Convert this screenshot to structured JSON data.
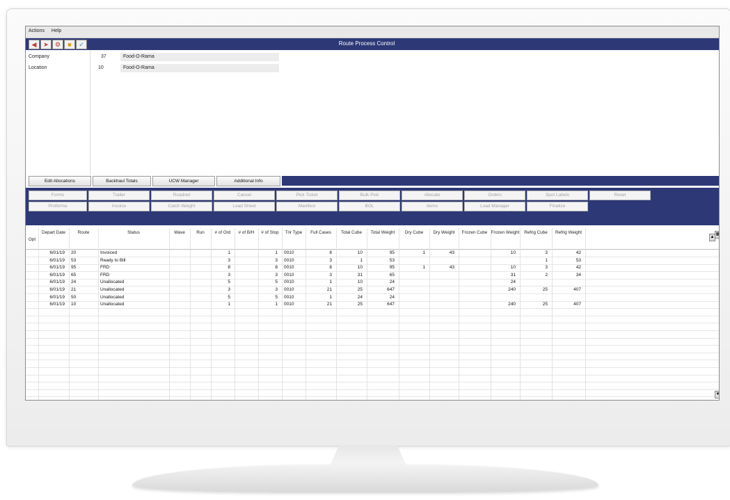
{
  "menu": [
    "Actions",
    "Help"
  ],
  "window_title": "Route Process Control",
  "toolbar_icons": [
    "back-arrow-icon",
    "forward-icon",
    "gear-icon",
    "folder-icon",
    "checklist-icon"
  ],
  "form": {
    "company_label": "Company",
    "company_code": "37",
    "company_name": "Food-O-Rama",
    "location_label": "Location",
    "location_code": "10",
    "location_name": "Food-O-Rama"
  },
  "tabs": [
    "Edit Allocations",
    "Backhaul Totals",
    "UCW Manager",
    "Additional Info"
  ],
  "action_row1": [
    "Forms",
    "Trailer",
    "Roadnet",
    "Cancel",
    "Pick Ticket",
    "Bulk Pick",
    "Allocate",
    "Orders",
    "Spot Labels",
    "Reset"
  ],
  "action_row2": [
    "Proforma",
    "Invoice",
    "Catch Weight",
    "Load Sheet",
    "Manifest",
    "BOL",
    "Items",
    "Load Manager",
    "Finalize"
  ],
  "columns": [
    "Opt",
    "Depart Date",
    "Route",
    "Status",
    "Wave",
    "Run",
    "# of Ord",
    "# of B/H",
    "# of Stop",
    "Trir Type",
    "Full Cases",
    "Total Cube",
    "Total Weight",
    "Dry Cube",
    "Dry Weight",
    "Frozen Cube",
    "Frozen Weight",
    "Refrig Cube",
    "Refrig Weight"
  ],
  "rows": [
    {
      "date": "6/01/19",
      "route": "20",
      "status": "Invoiced",
      "ord": "1",
      "stop": "1",
      "trlr": "0010",
      "cases": "8",
      "tcube": "10",
      "tweight": "95",
      "dcube": "1",
      "dweight": "43",
      "fcube": "",
      "fweight": "10",
      "rcube": "3",
      "rweight": "42"
    },
    {
      "date": "6/01/19",
      "route": "53",
      "status": "Ready to Bill",
      "ord": "3",
      "stop": "3",
      "trlr": "0010",
      "cases": "3",
      "tcube": "1",
      "tweight": "53",
      "dcube": "",
      "dweight": "",
      "fcube": "",
      "fweight": "",
      "rcube": "1",
      "rweight": "53"
    },
    {
      "date": "6/01/19",
      "route": "95",
      "status": "FRD",
      "ord": "8",
      "stop": "8",
      "trlr": "0010",
      "cases": "8",
      "tcube": "10",
      "tweight": "95",
      "dcube": "1",
      "dweight": "43",
      "fcube": "",
      "fweight": "10",
      "rcube": "3",
      "rweight": "42"
    },
    {
      "date": "6/01/19",
      "route": "65",
      "status": "FRD",
      "ord": "3",
      "stop": "3",
      "trlr": "0010",
      "cases": "3",
      "tcube": "31",
      "tweight": "65",
      "dcube": "",
      "dweight": "",
      "fcube": "",
      "fweight": "31",
      "rcube": "2",
      "rweight": "34"
    },
    {
      "date": "6/01/19",
      "route": "24",
      "status": "Unallocated",
      "ord": "5",
      "stop": "5",
      "trlr": "0010",
      "cases": "1",
      "tcube": "10",
      "tweight": "24",
      "dcube": "",
      "dweight": "",
      "fcube": "",
      "fweight": "24",
      "rcube": "",
      "rweight": ""
    },
    {
      "date": "6/01/19",
      "route": "21",
      "status": "Unallocated",
      "ord": "3",
      "stop": "3",
      "trlr": "0010",
      "cases": "21",
      "tcube": "25",
      "tweight": "647",
      "dcube": "",
      "dweight": "",
      "fcube": "",
      "fweight": "240",
      "rcube": "25",
      "rweight": "407"
    },
    {
      "date": "6/01/19",
      "route": "50",
      "status": "Unallocated",
      "ord": "5",
      "stop": "5",
      "trlr": "0010",
      "cases": "1",
      "tcube": "24",
      "tweight": "24",
      "dcube": "",
      "dweight": "",
      "fcube": "",
      "fweight": "",
      "rcube": "",
      "rweight": ""
    },
    {
      "date": "6/01/19",
      "route": "10",
      "status": "Unallocated",
      "ord": "1",
      "stop": "1",
      "trlr": "0010",
      "cases": "21",
      "tcube": "25",
      "tweight": "647",
      "dcube": "",
      "dweight": "",
      "fcube": "",
      "fweight": "240",
      "rcube": "25",
      "rweight": "407"
    }
  ]
}
